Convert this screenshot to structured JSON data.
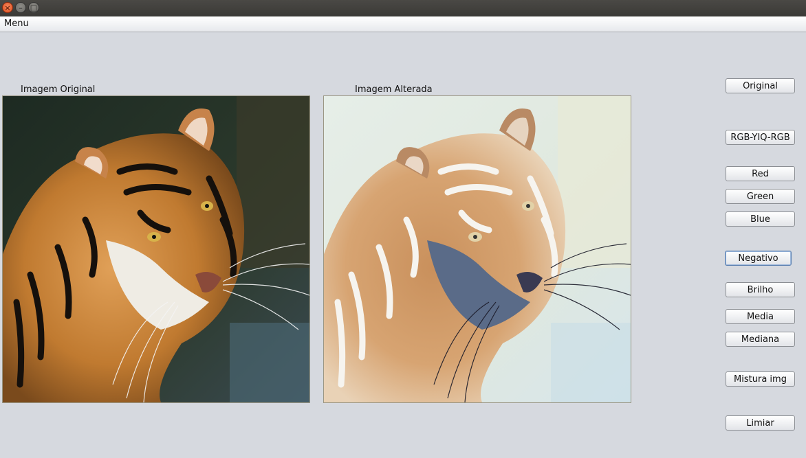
{
  "window": {
    "title": "",
    "controls": {
      "close": "×",
      "minimize": "–",
      "maximize": "□"
    }
  },
  "menubar": {
    "menu_label": "Menu"
  },
  "panels": {
    "original_label": "Imagem Original",
    "altered_label": "Imagem Alterada"
  },
  "buttons": {
    "original": "Original",
    "rgb_yiq_rgb": "RGB-YIQ-RGB",
    "red": "Red",
    "green": "Green",
    "blue": "Blue",
    "negativo": "Negativo",
    "brilho": "Brilho",
    "media": "Media",
    "mediana": "Mediana",
    "mistura_img": "Mistura img",
    "limiar": "Limiar"
  },
  "colors": {
    "background": "#d6d9df",
    "titlebar": "#3c3b37",
    "close_button": "#e95420"
  }
}
